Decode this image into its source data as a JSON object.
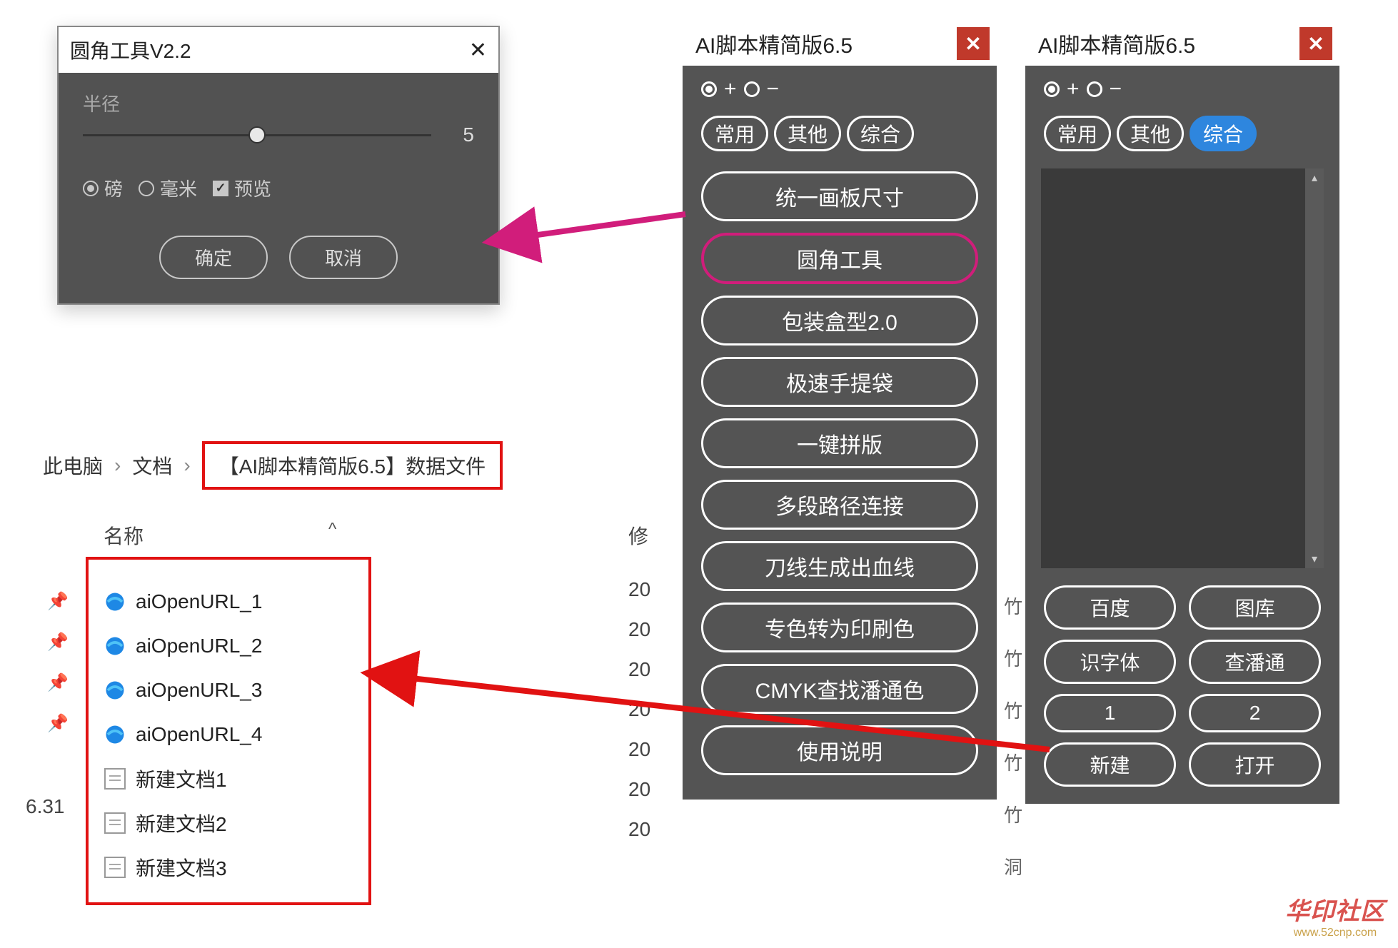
{
  "dialog": {
    "title": "圆角工具V2.2",
    "close": "✕",
    "radius_label": "半径",
    "radius_value": "5",
    "unit_pound": "磅",
    "unit_mm": "毫米",
    "preview": "预览",
    "ok": "确定",
    "cancel": "取消"
  },
  "breadcrumb": {
    "root": "此电脑",
    "docs": "文档",
    "folder": "【AI脚本精简版6.5】数据文件"
  },
  "filelist": {
    "col_name": "名称",
    "col_mod": "修",
    "sort_caret": "^",
    "truncated": "20",
    "items": [
      {
        "icon": "link",
        "name": "aiOpenURL_1"
      },
      {
        "icon": "link",
        "name": "aiOpenURL_2"
      },
      {
        "icon": "link",
        "name": "aiOpenURL_3"
      },
      {
        "icon": "link",
        "name": "aiOpenURL_4"
      },
      {
        "icon": "doc",
        "name": "新建文档1"
      },
      {
        "icon": "doc",
        "name": "新建文档2"
      },
      {
        "icon": "doc",
        "name": "新建文档3"
      }
    ],
    "extra_left": "6.31"
  },
  "panel1": {
    "title": "AI脚本精简版6.5",
    "close": "✕",
    "mode_plus": "+",
    "mode_minus": "−",
    "tabs": [
      "常用",
      "其他",
      "综合"
    ],
    "buttons": [
      "统一画板尺寸",
      "圆角工具",
      "包装盒型2.0",
      "极速手提袋",
      "一键拼版",
      "多段路径连接",
      "刀线生成出血线",
      "专色转为印刷色",
      "CMYK查找潘通色",
      "使用说明"
    ],
    "highlight_index": 1
  },
  "panel2": {
    "title": "AI脚本精简版6.5",
    "close": "✕",
    "mode_plus": "+",
    "mode_minus": "−",
    "tabs": [
      "常用",
      "其他",
      "综合"
    ],
    "active_tab": 2,
    "grid": [
      "百度",
      "图库",
      "识字体",
      "查潘通",
      "1",
      "2",
      "新建",
      "打开"
    ]
  },
  "fragments": [
    "竹",
    "竹",
    "竹",
    "竹",
    "竹",
    "洞"
  ],
  "watermark": {
    "logo": "华印社区",
    "url": "www.52cnp.com"
  }
}
